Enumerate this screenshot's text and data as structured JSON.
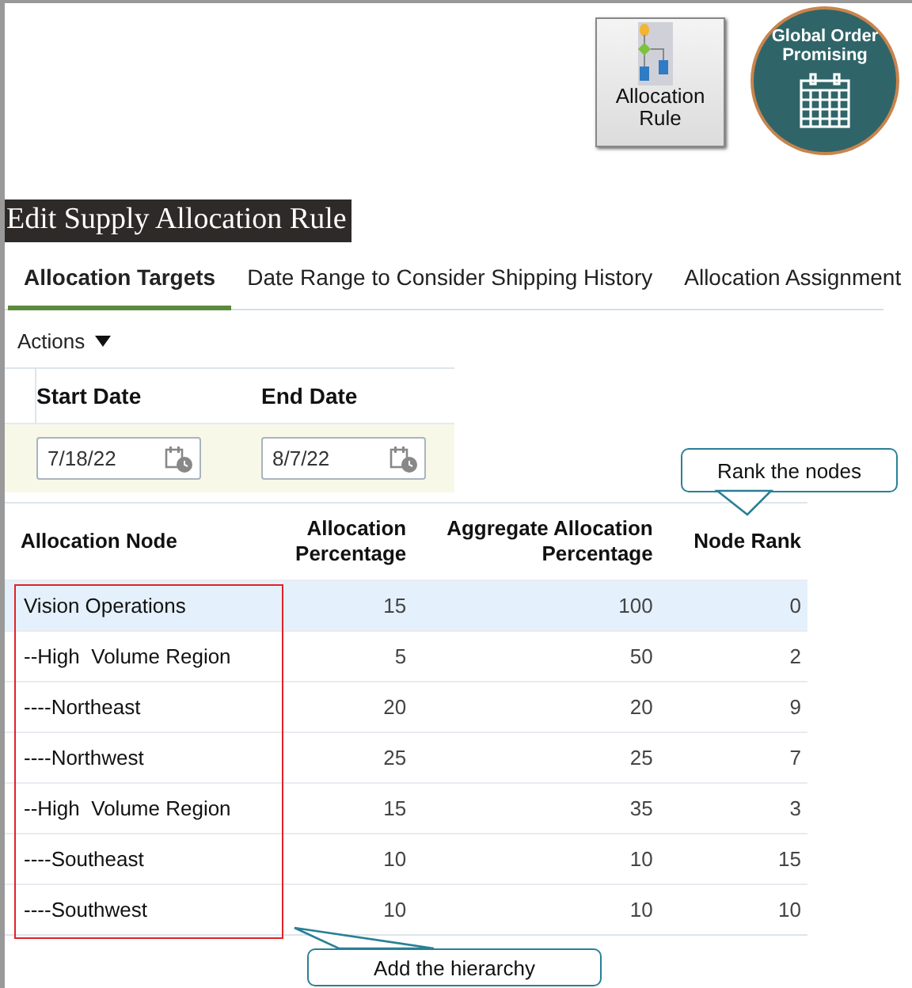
{
  "toolbar": {
    "allocation_rule_button": "Allocation\nRule",
    "global_order_promising_button": "Global Order\nPromising"
  },
  "page_title": "Edit Supply Allocation Rule",
  "tabs": [
    {
      "label": "Allocation Targets",
      "selected": true
    },
    {
      "label": "Date Range to Consider Shipping History",
      "selected": false
    },
    {
      "label": "Allocation Assignment",
      "selected": false
    }
  ],
  "actions_menu": "Actions",
  "date_range": {
    "columns": [
      "Start Date",
      "End Date"
    ],
    "values": [
      "7/18/22",
      "8/7/22"
    ]
  },
  "table": {
    "columns": [
      "Allocation Node",
      "Allocation\nPercentage",
      "Aggregate Allocation\nPercentage",
      "Node Rank"
    ],
    "rows": [
      {
        "cells": [
          "Vision Operations",
          "15",
          "100",
          "0"
        ],
        "selected": true
      },
      {
        "cells": [
          "--High  Volume Region",
          "5",
          "50",
          "2"
        ],
        "selected": false
      },
      {
        "cells": [
          "----Northeast",
          "20",
          "20",
          "9"
        ],
        "selected": false
      },
      {
        "cells": [
          "----Northwest",
          "25",
          "25",
          "7"
        ],
        "selected": false
      },
      {
        "cells": [
          "--High  Volume Region",
          "15",
          "35",
          "3"
        ],
        "selected": false
      },
      {
        "cells": [
          "----Southeast",
          "10",
          "10",
          "15"
        ],
        "selected": false
      },
      {
        "cells": [
          "----Southwest",
          "10",
          "10",
          "10"
        ],
        "selected": false
      }
    ]
  },
  "callouts": [
    {
      "kind": "top",
      "text": "Rank the nodes"
    },
    {
      "kind": "bottom",
      "text": "Add the hierarchy"
    }
  ]
}
